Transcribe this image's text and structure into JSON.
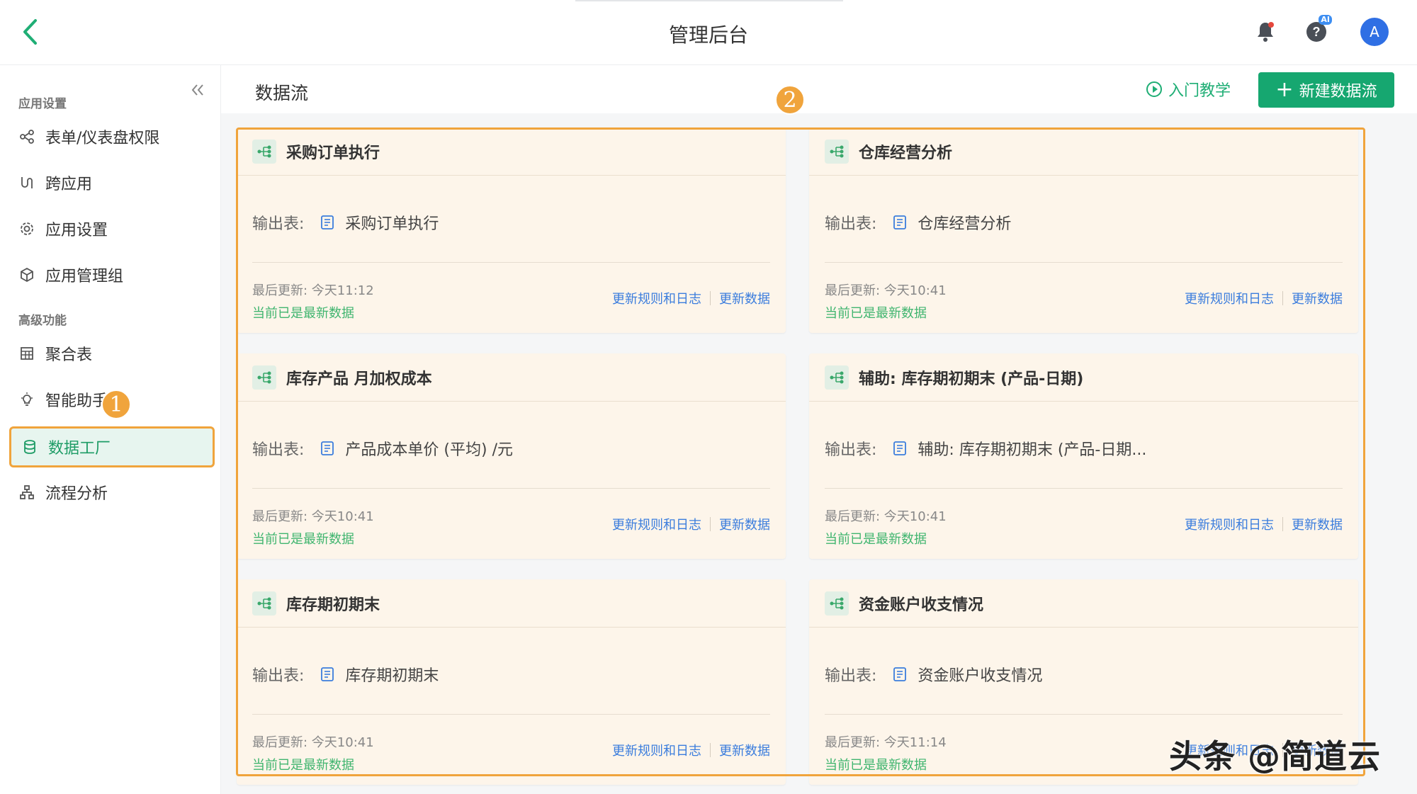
{
  "header": {
    "title": "管理后台",
    "help_badge": "AI",
    "avatar_letter": "A"
  },
  "sidebar": {
    "section_app": "应用设置",
    "section_advanced": "高级功能",
    "items": [
      {
        "label": "表单/仪表盘权限",
        "icon": "share-icon"
      },
      {
        "label": "跨应用",
        "icon": "cross-app-icon"
      },
      {
        "label": "应用设置",
        "icon": "gear-icon"
      },
      {
        "label": "应用管理组",
        "icon": "cube-icon"
      },
      {
        "label": "聚合表",
        "icon": "table-grid-icon"
      },
      {
        "label": "智能助手",
        "icon": "bulb-icon"
      },
      {
        "label": "数据工厂",
        "icon": "database-icon",
        "active": true
      },
      {
        "label": "流程分析",
        "icon": "flow-chart-icon"
      }
    ]
  },
  "annotations": {
    "badge1": "1",
    "badge2": "2"
  },
  "main": {
    "title": "数据流",
    "tutorial_label": "入门教学",
    "new_button_label": "新建数据流",
    "output_label": "输出表:",
    "rules_log_label": "更新规则和日志",
    "update_data_label": "更新数据",
    "cards": [
      {
        "title": "采购订单执行",
        "output": "采购订单执行",
        "updated": "最后更新: 今天11:12",
        "status": "当前已是最新数据"
      },
      {
        "title": "仓库经营分析",
        "output": "仓库经营分析",
        "updated": "最后更新: 今天10:41",
        "status": "当前已是最新数据"
      },
      {
        "title": "库存产品 月加权成本",
        "output": "产品成本单价 (平均) /元",
        "updated": "最后更新: 今天10:41",
        "status": "当前已是最新数据"
      },
      {
        "title": "辅助: 库存期初期末 (产品-日期)",
        "output": "辅助: 库存期初期末 (产品-日期...",
        "updated": "最后更新: 今天10:41",
        "status": "当前已是最新数据"
      },
      {
        "title": "库存期初期末",
        "output": "库存期初期末",
        "updated": "最后更新: 今天10:41",
        "status": "当前已是最新数据"
      },
      {
        "title": "资金账户收支情况",
        "output": "资金账户收支情况",
        "updated": "最后更新: 今天11:14",
        "status": "当前已是最新数据"
      }
    ]
  },
  "watermark": "头条 @简道云",
  "colors": {
    "accent": "#16a770",
    "highlight": "#f0a43c",
    "link": "#3b7ddd",
    "card_bg": "#fdf5ea"
  }
}
